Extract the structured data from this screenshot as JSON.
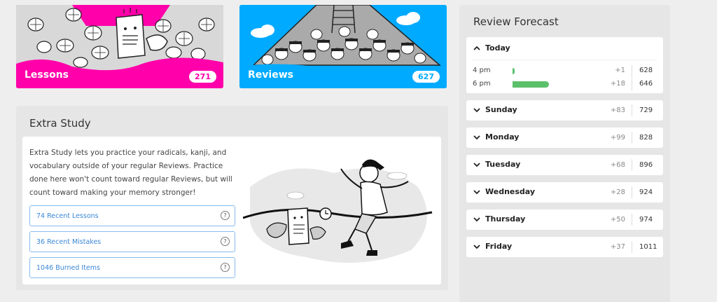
{
  "cards": {
    "lessons": {
      "label": "Lessons",
      "count": "271",
      "color": "#ff00aa"
    },
    "reviews": {
      "label": "Reviews",
      "count": "627",
      "color": "#00aaff"
    }
  },
  "extra_study": {
    "title": "Extra Study",
    "description": "Extra Study lets you practice your radicals, kanji, and vocabulary outside of your regular Reviews. Practice done here won't count toward regular Reviews, but will count toward making your memory stronger!",
    "buttons": [
      {
        "label": "74 Recent Lessons",
        "help_icon": "?"
      },
      {
        "label": "36 Recent Mistakes",
        "help_icon": "?"
      },
      {
        "label": "1046 Burned Items",
        "help_icon": "?"
      }
    ]
  },
  "forecast": {
    "title": "Review Forecast",
    "bar_color": "#5cbf6a",
    "today": {
      "name": "Today",
      "hours": [
        {
          "time": "4 pm",
          "plus": "+1",
          "total": "628",
          "fraction": 0.06
        },
        {
          "time": "6 pm",
          "plus": "+18",
          "total": "646",
          "fraction": 0.94
        }
      ]
    },
    "days": [
      {
        "name": "Sunday",
        "plus": "+83",
        "total": "729"
      },
      {
        "name": "Monday",
        "plus": "+99",
        "total": "828"
      },
      {
        "name": "Tuesday",
        "plus": "+68",
        "total": "896"
      },
      {
        "name": "Wednesday",
        "plus": "+28",
        "total": "924"
      },
      {
        "name": "Thursday",
        "plus": "+50",
        "total": "974"
      },
      {
        "name": "Friday",
        "plus": "+37",
        "total": "1011"
      }
    ]
  }
}
